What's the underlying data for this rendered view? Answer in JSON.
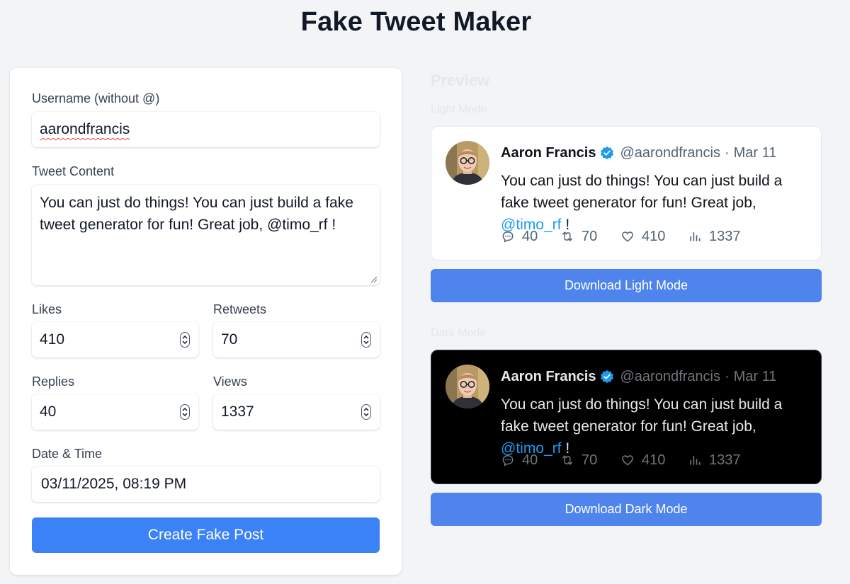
{
  "app": {
    "title": "Fake Tweet Maker"
  },
  "form": {
    "username_label": "Username (without @)",
    "username_value": "aarondfrancis",
    "content_label": "Tweet Content",
    "content_value": "You can just do things! You can just build a fake tweet generator for fun! Great job, @timo_rf !",
    "likes_label": "Likes",
    "likes_value": "410",
    "retweets_label": "Retweets",
    "retweets_value": "70",
    "replies_label": "Replies",
    "replies_value": "40",
    "views_label": "Views",
    "views_value": "1337",
    "datetime_label": "Date & Time",
    "datetime_value": "03/11/2025, 08:19 PM",
    "create_label": "Create Fake Post"
  },
  "preview": {
    "title": "Preview",
    "light_label": "Light Mode",
    "dark_label": "Dark Mode",
    "download_light": "Download Light Mode",
    "download_dark": "Download Dark Mode"
  },
  "tweet": {
    "display_name": "Aaron Francis",
    "handle": "@aarondfrancis",
    "separator": "·",
    "date": "Mar 11",
    "text_before": "You can just do things! You can just build a fake tweet generator for fun! Great job, ",
    "mention": "@timo_rf",
    "text_after": " !",
    "replies": "40",
    "retweets": "70",
    "likes": "410",
    "views": "1337"
  },
  "colors": {
    "accent": "#3b82f6",
    "download_button": "#4f84ec",
    "verified": "#1d9bf0",
    "mention": "#1d9bf0",
    "page_background": "#f3f4f6",
    "dark_tweet_background": "#000000"
  },
  "icons": [
    "verified-badge-icon",
    "reply-icon",
    "retweet-icon",
    "like-icon",
    "views-icon",
    "stepper-icon",
    "resize-grip-icon"
  ]
}
